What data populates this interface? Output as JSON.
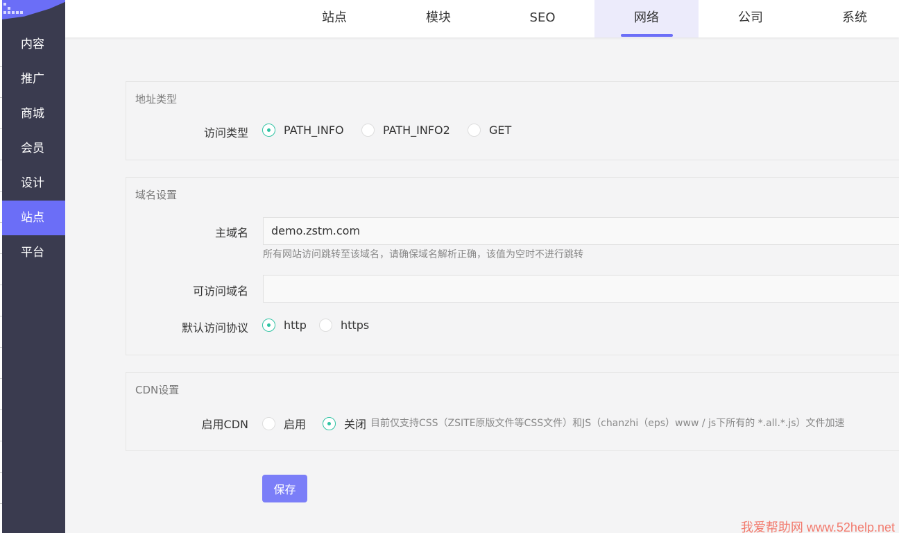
{
  "sidebar": {
    "items": [
      {
        "label": "内容"
      },
      {
        "label": "推广"
      },
      {
        "label": "商城"
      },
      {
        "label": "会员"
      },
      {
        "label": "设计"
      },
      {
        "label": "站点",
        "active": true
      },
      {
        "label": "平台"
      }
    ]
  },
  "topnav": {
    "tabs": [
      {
        "label": "站点"
      },
      {
        "label": "模块"
      },
      {
        "label": "SEO"
      },
      {
        "label": "网络",
        "active": true
      },
      {
        "label": "公司"
      },
      {
        "label": "系统"
      }
    ]
  },
  "address": {
    "title": "地址类型",
    "access_label": "访问类型",
    "options": [
      "PATH_INFO",
      "PATH_INFO2",
      "GET"
    ],
    "selected": "PATH_INFO"
  },
  "domain": {
    "title": "域名设置",
    "main_label": "主域名",
    "main_value": "demo.zstm.com",
    "main_help": "所有网站访问跳转至该域名，请确保域名解析正确，该值为空时不进行跳转",
    "allowed_label": "可访问域名",
    "allowed_value": "",
    "protocol_label": "默认访问协议",
    "protocol_options": [
      "http",
      "https"
    ],
    "protocol_selected": "http"
  },
  "cdn": {
    "title": "CDN设置",
    "enable_label": "启用CDN",
    "on_label": "启用",
    "off_label": "关闭",
    "selected": "关闭",
    "note": "目前仅支持CSS（ZSITE原版文件等CSS文件）和JS（chanzhi（eps）www / js下所有的 *.all.*.js）文件加速"
  },
  "save_label": "保存",
  "watermark": "我爱帮助网 www.52help.net",
  "colors": {
    "accent": "#6b6ef7",
    "radio": "#2fc3a3",
    "sidebar": "#3a3b4f"
  }
}
